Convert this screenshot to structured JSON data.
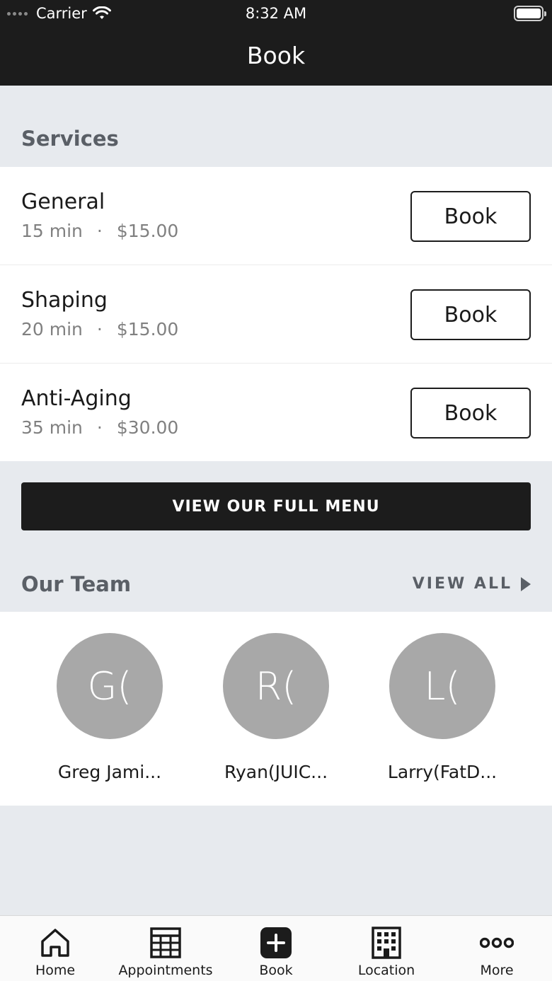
{
  "status_bar": {
    "carrier": "Carrier",
    "time": "8:32 AM"
  },
  "header": {
    "title": "Book"
  },
  "services_section": {
    "title": "Services",
    "items": [
      {
        "name": "General",
        "duration": "15 min",
        "separator": "·",
        "price": "$15.00",
        "button": "Book"
      },
      {
        "name": "Shaping",
        "duration": "20 min",
        "separator": "·",
        "price": "$15.00",
        "button": "Book"
      },
      {
        "name": "Anti-Aging",
        "duration": "35 min",
        "separator": "·",
        "price": "$30.00",
        "button": "Book"
      }
    ],
    "full_menu_button": "VIEW OUR FULL MENU"
  },
  "team_section": {
    "title": "Our Team",
    "view_all": "VIEW ALL",
    "members": [
      {
        "initials": "G(",
        "name": "Greg Jami..."
      },
      {
        "initials": "R(",
        "name": "Ryan(JUIC..."
      },
      {
        "initials": "L(",
        "name": "Larry(FatD..."
      }
    ]
  },
  "tabbar": {
    "items": [
      {
        "label": "Home",
        "icon": "home-icon"
      },
      {
        "label": "Appointments",
        "icon": "calendar-grid-icon"
      },
      {
        "label": "Book",
        "icon": "plus-square-icon"
      },
      {
        "label": "Location",
        "icon": "building-icon"
      },
      {
        "label": "More",
        "icon": "more-dots-icon"
      }
    ]
  }
}
